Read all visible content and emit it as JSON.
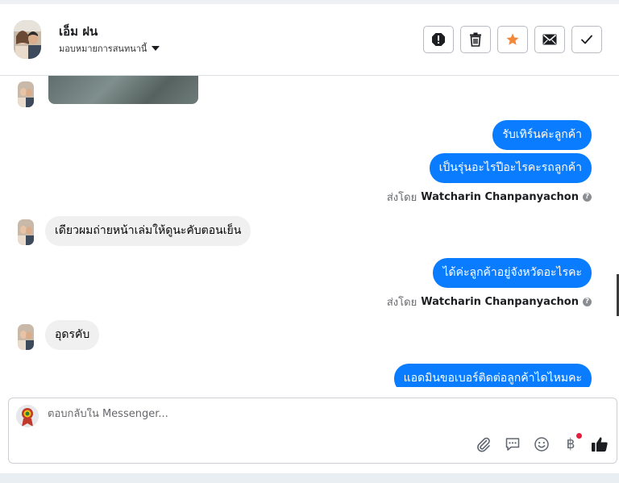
{
  "header": {
    "contact_name": "เอ็ม ฝน",
    "assign_label": "มอบหมายการสนทนานี้",
    "actions": [
      {
        "name": "report-button",
        "icon": "alert-octagon-icon"
      },
      {
        "name": "delete-button",
        "icon": "trash-icon"
      },
      {
        "name": "star-button",
        "icon": "star-icon"
      },
      {
        "name": "mark-unread-button",
        "icon": "envelope-icon"
      },
      {
        "name": "mark-done-button",
        "icon": "checkmark-icon"
      }
    ]
  },
  "messages": [
    {
      "side": "in",
      "type": "photo"
    },
    {
      "side": "out",
      "text": "รับเทิร์นค่ะลูกค้า"
    },
    {
      "side": "out",
      "text": "เป็นรุ่นอะไรปีอะไรคะรถลูกค้า"
    },
    {
      "side": "meta",
      "prefix": "ส่งโดย",
      "agent": "Watcharin Chanpanyachon"
    },
    {
      "side": "in",
      "text": "เดียวผมถ่ายหน้าเล่มให้ดูนะคับตอนเย็น"
    },
    {
      "side": "out",
      "text": "ได้ค่ะลูกค้าอยู่จังหวัดอะไรคะ"
    },
    {
      "side": "meta",
      "prefix": "ส่งโดย",
      "agent": "Watcharin Chanpanyachon"
    },
    {
      "side": "in",
      "text": "อุดรคับ"
    },
    {
      "side": "out",
      "text": "แอดมินขอเบอร์ติดต่อลูกค้าไดไหมคะ"
    }
  ],
  "composer": {
    "placeholder": "ตอบกลับใน Messenger...",
    "value": "",
    "tools": [
      "attach-icon",
      "saved-replies-icon",
      "emoji-icon",
      "payment-icon",
      "thumbs-up-icon"
    ],
    "payment_symbol": "฿"
  },
  "colors": {
    "outgoing_bubble": "#0a7cff",
    "incoming_bubble": "#f0f0f0",
    "star": "#f5873a",
    "notification_dot": "#e41e3f"
  }
}
